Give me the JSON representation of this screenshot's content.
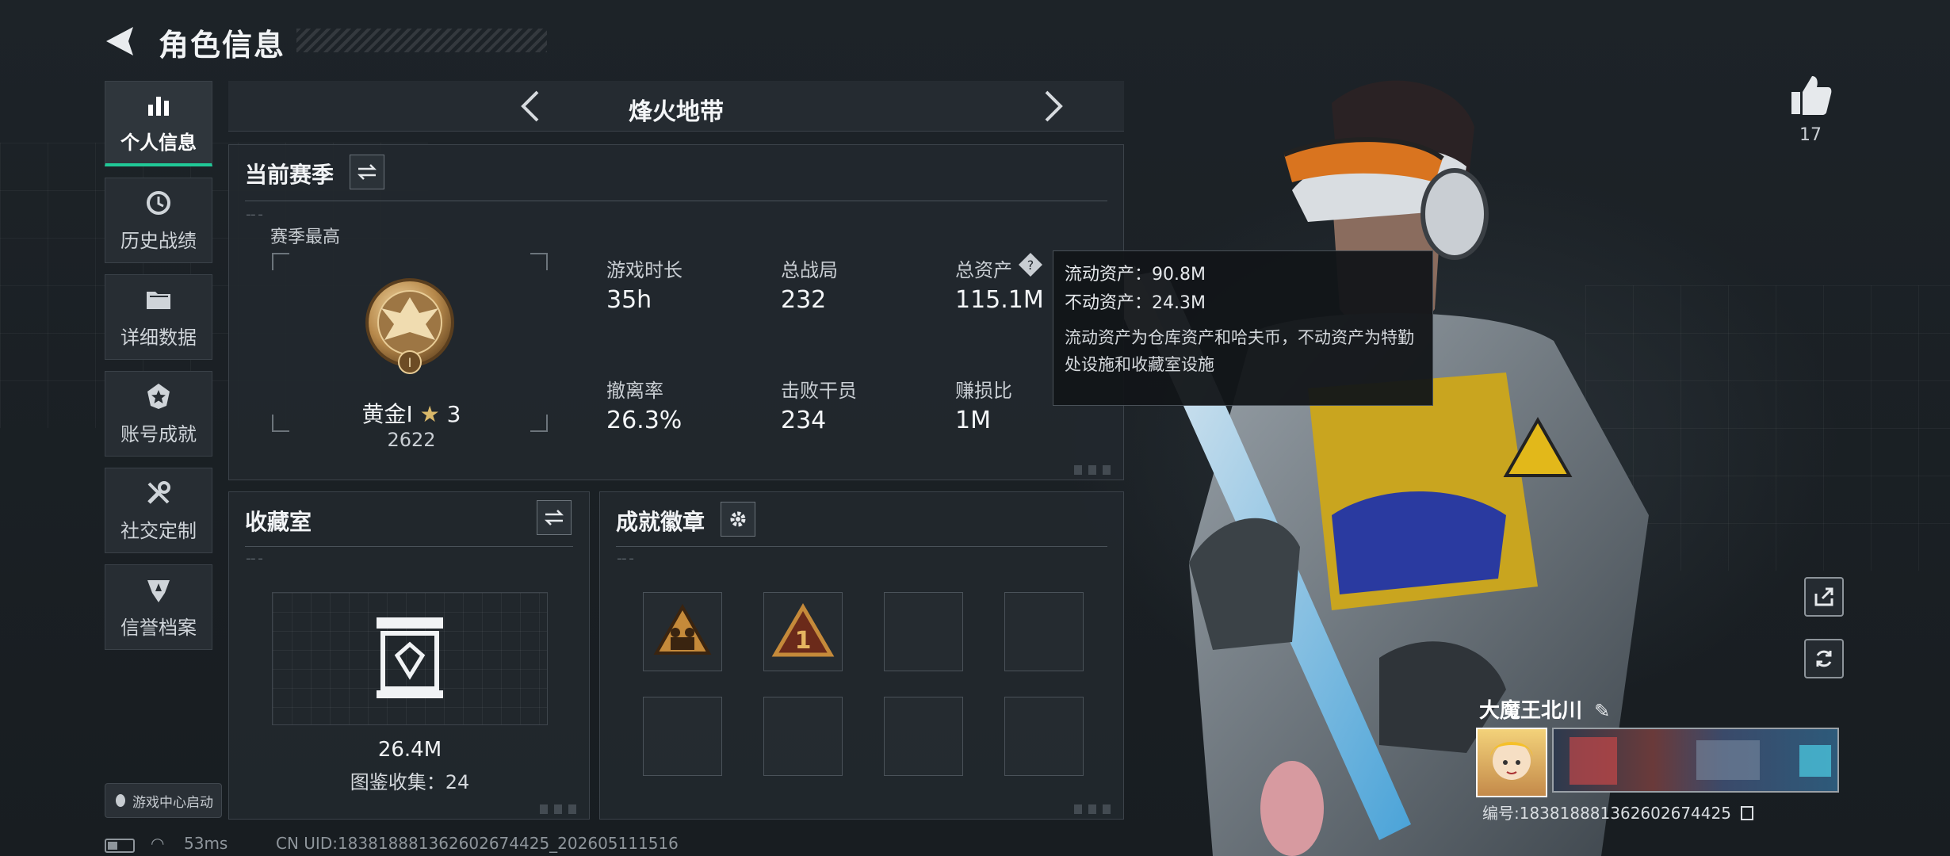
{
  "header": {
    "title": "角色信息"
  },
  "sidebar": {
    "items": [
      {
        "label": "个人信息",
        "icon": "bar-chart-icon",
        "active": true
      },
      {
        "label": "历史战绩",
        "icon": "history-clock-icon",
        "active": false
      },
      {
        "label": "详细数据",
        "icon": "folder-icon",
        "active": false
      },
      {
        "label": "账号成就",
        "icon": "achievement-star-icon",
        "active": false
      },
      {
        "label": "社交定制",
        "icon": "tools-icon",
        "active": false
      },
      {
        "label": "信誉档案",
        "icon": "shield-emblem-icon",
        "active": false
      }
    ],
    "game_center_label": "游戏中心启动"
  },
  "mode_bar": {
    "title": "烽火地带"
  },
  "season_panel": {
    "title": "当前赛季",
    "season_high_label": "赛季最高",
    "rank_name": "黄金I",
    "rank_stars": "3",
    "rank_score": "2622",
    "stats": [
      {
        "label": "游戏时长",
        "value": "35h"
      },
      {
        "label": "总战局",
        "value": "232"
      },
      {
        "label": "总资产",
        "value": "115.1M"
      },
      {
        "label": "撤离率",
        "value": "26.3%"
      },
      {
        "label": "击败干员",
        "value": "234"
      },
      {
        "label": "赚损比",
        "value": "1M"
      }
    ]
  },
  "tooltip": {
    "line1": "流动资产：90.8M",
    "line2": "不动资产：24.3M",
    "description": "流动资产为仓库资产和哈夫币，不动资产为特勤处设施和收藏室设施"
  },
  "collection_panel": {
    "title": "收藏室",
    "value": "26.4M",
    "catalog_label": "图鉴收集：24"
  },
  "badges_panel": {
    "title": "成就徽章",
    "slots": [
      {
        "filled": true,
        "icon": "squad-badge-icon"
      },
      {
        "filled": true,
        "icon": "first-place-badge-icon"
      },
      {
        "filled": false
      },
      {
        "filled": false
      },
      {
        "filled": false
      },
      {
        "filled": false
      },
      {
        "filled": false
      },
      {
        "filled": false
      }
    ]
  },
  "right": {
    "likes": "17",
    "player_name": "大魔王北川",
    "player_id": "编号:18381888136260267442​5"
  },
  "status": {
    "ping": "53ms",
    "uid": "CN UID:18381888136260267442​5_202605111516"
  },
  "colors": {
    "accent": "#20c997",
    "panel": "#22282e",
    "background": "#1b2126"
  }
}
